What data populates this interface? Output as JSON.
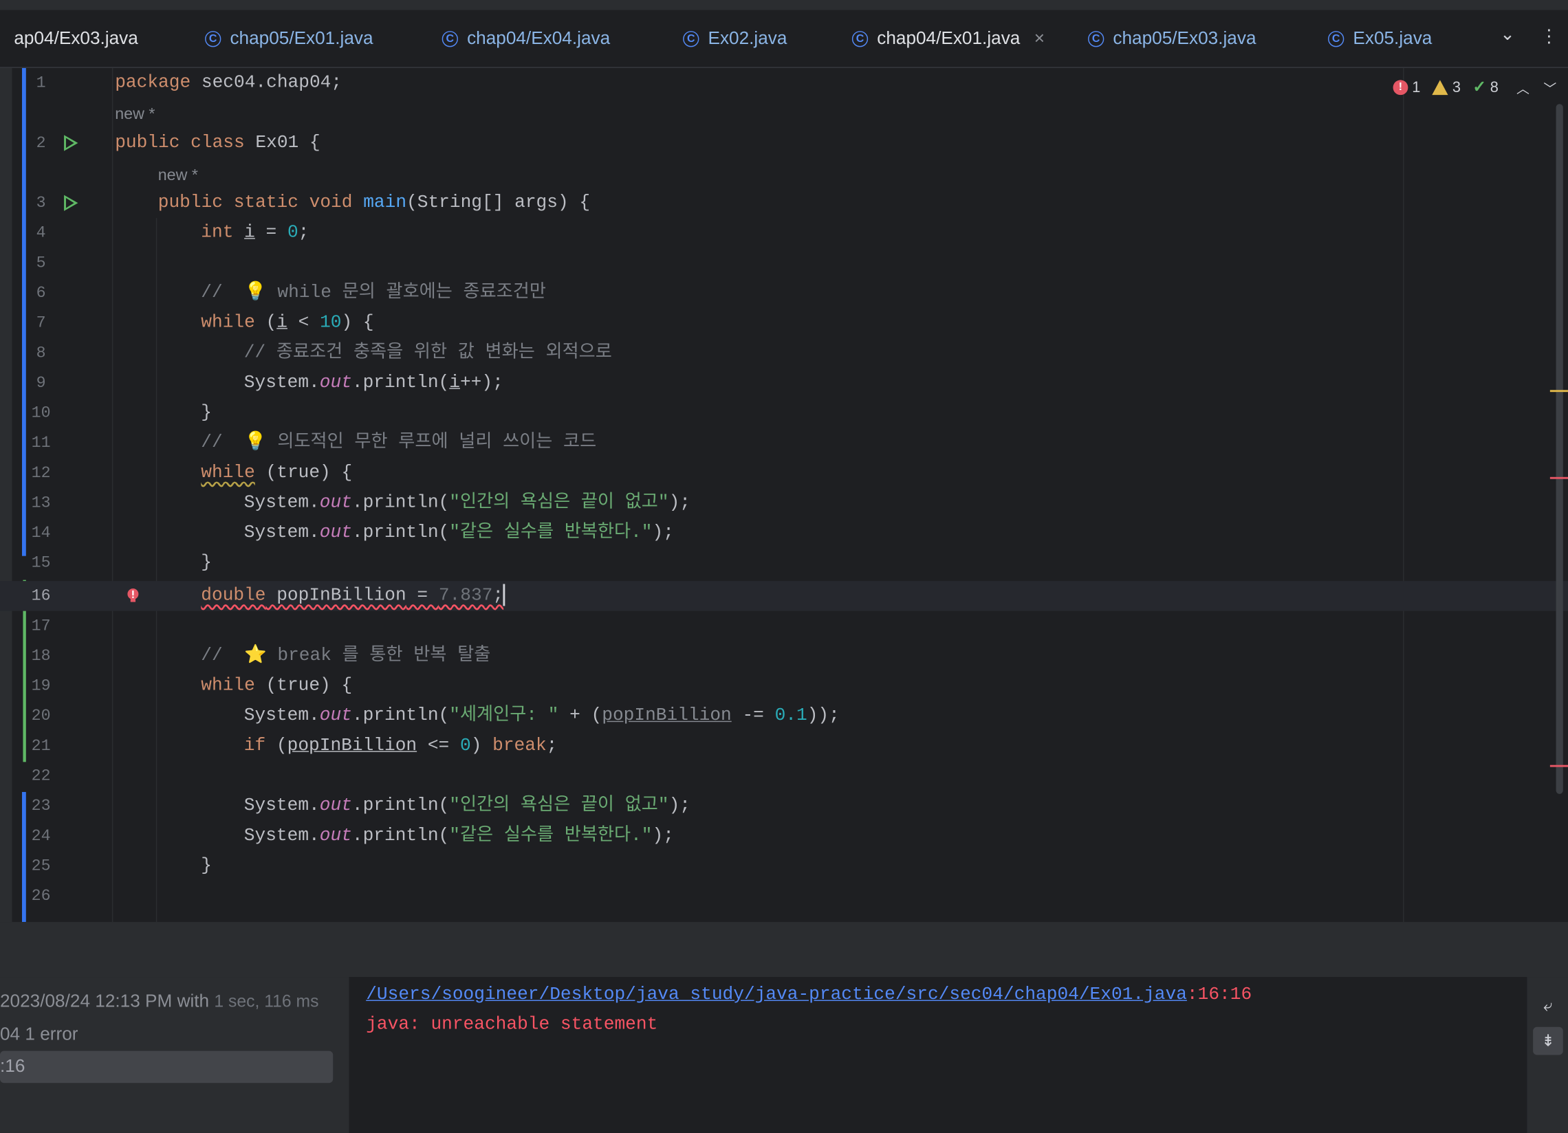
{
  "tabs": [
    {
      "label": "ap04/Ex03.java",
      "icon": "class-icon",
      "active": false
    },
    {
      "label": "chap05/Ex01.java",
      "icon": "class-icon",
      "active": false
    },
    {
      "label": "chap04/Ex04.java",
      "icon": "class-icon",
      "active": false
    },
    {
      "label": "Ex02.java",
      "icon": "class-icon",
      "active": false
    },
    {
      "label": "chap04/Ex01.java",
      "icon": "class-icon",
      "active": true
    },
    {
      "label": "chap05/Ex03.java",
      "icon": "class-icon",
      "active": false
    },
    {
      "label": "Ex05.java",
      "icon": "class-icon",
      "active": false
    }
  ],
  "tab_close_glyph": "×",
  "tab_class_glyph": "C",
  "tabbar": {
    "more_tabs_icon": "chevron-down-icon",
    "menu_icon": "more-vertical-icon",
    "more_tabs_glyph": "⌄",
    "menu_glyph": "⋮"
  },
  "inspections": {
    "errors": "1",
    "warnings": "3",
    "ok": "8",
    "prev_glyph": "︿",
    "next_glyph": "﹀"
  },
  "hints": {
    "new_a": "new *",
    "new_b": "new *"
  },
  "line_numbers": [
    "1",
    "2",
    "3",
    "4",
    "5",
    "6",
    "7",
    "8",
    "9",
    "10",
    "11",
    "12",
    "13",
    "14",
    "15",
    "16",
    "17",
    "18",
    "19",
    "20",
    "21",
    "22",
    "23",
    "24",
    "25",
    "26"
  ],
  "code": {
    "l1_kw": "package",
    "l1_rest": " sec04.chap04;",
    "l2_kw": "public class",
    "l2_rest": " Ex01 {",
    "l3_kw": "public static void",
    "l3_fn": "main",
    "l3_rest": "(String[] args) {",
    "l4_kw": "int",
    "l4_var": "i",
    "l4_eq": " = ",
    "l4_num": "0",
    "l4_end": ";",
    "l6_cmt": "//  💡 while 문의 괄호에는 종료조건만",
    "l7_kw": "while",
    "l7_a": " (",
    "l7_var": "i",
    "l7_b": " < ",
    "l7_num": "10",
    "l7_c": ") {",
    "l8_cmt": "// 종료조건 충족을 위한 값 변화는 외적으로",
    "l9_a": "System.",
    "l9_out": "out",
    "l9_b": ".println(",
    "l9_var": "i",
    "l9_c": "++);",
    "l10": "}",
    "l11_cmt": "//  💡 의도적인 무한 루프에 널리 쓰이는 코드",
    "l12_kw": "while",
    "l12_rest": " (true) {",
    "l13_a": "System.",
    "l13_out": "out",
    "l13_b": ".println(",
    "l13_str": "\"인간의 욕심은 끝이 없고\"",
    "l13_c": ");",
    "l14_a": "System.",
    "l14_out": "out",
    "l14_b": ".println(",
    "l14_str": "\"같은 실수를 반복한다.\"",
    "l14_c": ");",
    "l15": "}",
    "l16_kw": "double",
    "l16_var": " popInBillion",
    "l16_eq": " = ",
    "l16_num": "7.837",
    "l16_end": ";",
    "l18_cmt": "//  ⭐ break 를 통한 반복 탈출",
    "l19_kw": "while",
    "l19_rest": " (true) {",
    "l20_a": "System.",
    "l20_out": "out",
    "l20_b": ".println(",
    "l20_str": "\"세계인구: \"",
    "l20_c": " + (",
    "l20_var": "popInBillion",
    "l20_d": " -= ",
    "l20_num": "0.1",
    "l20_e": "));",
    "l21_kw": "if",
    "l21_a": " (",
    "l21_var": "popInBillion",
    "l21_b": " <= ",
    "l21_num": "0",
    "l21_c": ") ",
    "l21_kw2": "break",
    "l21_d": ";",
    "l23_a": "System.",
    "l23_out": "out",
    "l23_b": ".println(",
    "l23_str": "\"인간의 욕심은 끝이 없고\"",
    "l23_c": ");",
    "l24_a": "System.",
    "l24_out": "out",
    "l24_b": ".println(",
    "l24_str": "\"같은 실수를 반복한다.\"",
    "l24_c": ");",
    "l25": "}"
  },
  "build": {
    "line1": "2023/08/24 12:13 PM with",
    "line1_muted": "1 sec, 116 ms",
    "line2": "04 1 error",
    "line3": ":16"
  },
  "console": {
    "path": "/Users/soogineer/Desktop/java_study/java-practice/src/sec04/chap04/Ex01.java",
    "pos": ":16:16",
    "message": "java: unreachable statement"
  },
  "right_tools": {
    "wrap_icon": "soft-wrap-icon",
    "scroll_icon": "scroll-to-end-icon",
    "wrap_glyph": "⤶",
    "scroll_glyph": "⇟"
  },
  "colors": {
    "accent": "#3574f0",
    "keyword": "#cf8e6d",
    "string": "#6aab73",
    "error": "#f75464",
    "number": "#2aacb8"
  }
}
